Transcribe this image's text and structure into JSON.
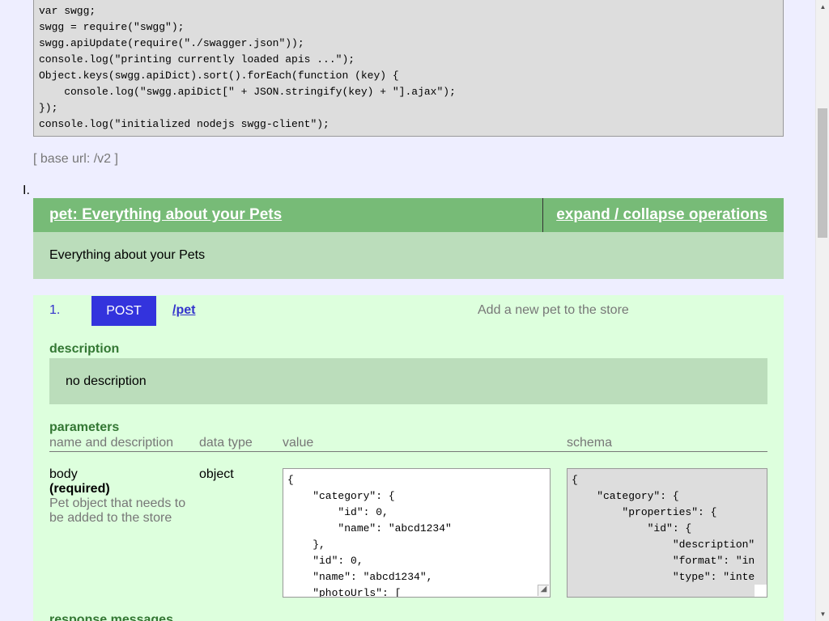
{
  "code_block": {
    "text": "var swgg;\nswgg = require(\"swgg\");\nswgg.apiUpdate(require(\"./swagger.json\"));\nconsole.log(\"printing currently loaded apis ...\");\nObject.keys(swgg.apiDict).sort().forEach(function (key) {\n    console.log(\"swgg.apiDict[\" + JSON.stringify(key) + \"].ajax\");\n});\nconsole.log(\"initialized nodejs swgg-client\");"
  },
  "base_url": "[ base url: /v2 ]",
  "resource": {
    "index": "I.",
    "title": "pet:  Everything about your Pets",
    "toggle_label": "expand / collapse operations",
    "description": "Everything about your Pets"
  },
  "operation": {
    "number": "1.",
    "method": "POST",
    "path": "/pet",
    "summary": "Add a new pet to the store",
    "description_label": "description",
    "description_text": "no description",
    "parameters_label": "parameters",
    "param_headers": {
      "name": "name and description",
      "type": "data type",
      "value": "value",
      "schema": "schema"
    },
    "param": {
      "name": "body",
      "required": "(required)",
      "description": "Pet object that needs to be added to the store",
      "type": "object",
      "value": "{\n    \"category\": {\n        \"id\": 0,\n        \"name\": \"abcd1234\"\n    },\n    \"id\": 0,\n    \"name\": \"abcd1234\",\n    \"photoUrls\": [",
      "schema": "{\n    \"category\": {\n        \"properties\": {\n            \"id\": {\n                \"description\"\n                \"format\": \"in\n                \"type\": \"inte"
    },
    "response_label": "response messages"
  }
}
